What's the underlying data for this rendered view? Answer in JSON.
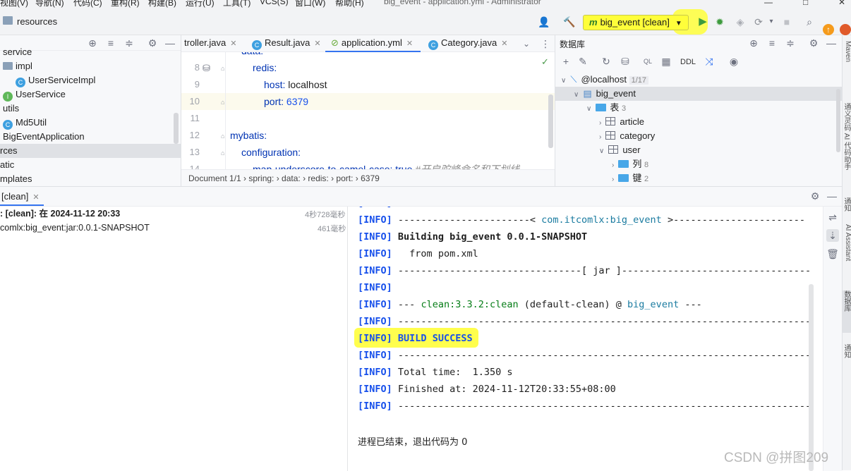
{
  "menubar": {
    "items": [
      "视图(V)",
      "导航(N)",
      "代码(C)",
      "重构(R)",
      "构建(B)",
      "运行(U)",
      "工具(T)",
      "VCS(S)",
      "窗口(W)",
      "帮助(H)"
    ],
    "title": "big_event - application.yml - Administrator"
  },
  "toolbar": {
    "project_label": "resources",
    "run_config": "big_event [clean]",
    "run_config_icon": "m"
  },
  "project_tree": {
    "rows": [
      {
        "label": "service",
        "icon": "none"
      },
      {
        "label": "impl",
        "icon": "folder"
      },
      {
        "label": "UserServiceImpl",
        "icon": "class"
      },
      {
        "label": "UserService",
        "icon": "interface"
      },
      {
        "label": "utils",
        "icon": "none"
      },
      {
        "label": "Md5Util",
        "icon": "class"
      },
      {
        "label": "BigEventApplication",
        "icon": "none"
      },
      {
        "label": "rces",
        "icon": "none"
      },
      {
        "label": "atic",
        "icon": "none"
      },
      {
        "label": "mplates",
        "icon": "none"
      }
    ]
  },
  "editor": {
    "tabs": [
      {
        "label": "troller.java",
        "icon": "none"
      },
      {
        "label": "Result.java",
        "icon": "class"
      },
      {
        "label": "application.yml",
        "icon": "yaml"
      },
      {
        "label": "Category.java",
        "icon": "class"
      }
    ],
    "lines": [
      {
        "num": "",
        "key": "data:",
        "value": "",
        "type": "k"
      },
      {
        "num": "8",
        "key": "redis:",
        "value": "",
        "type": "k"
      },
      {
        "num": "9",
        "key": "host:",
        "value": "localhost",
        "type": "kv"
      },
      {
        "num": "10",
        "key": "port:",
        "value": "6379",
        "type": "kn"
      },
      {
        "num": "11",
        "key": "",
        "value": "",
        "type": "k"
      },
      {
        "num": "12",
        "key": "mybatis:",
        "value": "",
        "type": "k"
      },
      {
        "num": "13",
        "key": "configuration:",
        "value": "",
        "type": "k"
      },
      {
        "num": "14",
        "key": "map-underscore-to-camel-case:",
        "value": "true",
        "type": "partial",
        "comment": "#开启驼峰命名和下划线"
      }
    ],
    "breadcrumb": "Document 1/1  ›  spring:  ›  data:  ›  redis:  ›  port:  ›  6379"
  },
  "database": {
    "title": "数据库",
    "ddl": "DDL",
    "datasource": "@localhost",
    "datasource_count": "1/17",
    "schema": "big_event",
    "tables_label": "表",
    "tables_count": "3",
    "tables": [
      "article",
      "category",
      "user"
    ],
    "columns_label": "列",
    "columns_count": "8",
    "keys_label": "键",
    "keys_count": "2"
  },
  "right_strip": {
    "labels": [
      "Maven",
      "通义灵码 AI 代码助手",
      "通知",
      "AI Assistant",
      "数据库",
      "通知"
    ]
  },
  "run": {
    "tab_label": "[clean]",
    "tree": [
      {
        "label": ": [clean]: 在 2024-11-12 20:33",
        "time": "4秒728毫秒"
      },
      {
        "label": "comlx:big_event:jar:0.0.1-SNAPSHOT",
        "time": "461毫秒"
      }
    ],
    "console": [
      {
        "tag": "[INFO]",
        "text": "-----------------------< ",
        "link": "com.itcomlx:big_event",
        "tail": " >-----------------------"
      },
      {
        "tag": "[INFO]",
        "text": "Building big_event 0.0.1-SNAPSHOT",
        "bold": true
      },
      {
        "tag": "[INFO]",
        "text": "  from pom.xml"
      },
      {
        "tag": "[INFO]",
        "text": "--------------------------------[ jar ]---------------------------------"
      },
      {
        "tag": "[INFO]",
        "text": ""
      },
      {
        "tag": "[INFO]",
        "text": "--- ",
        "green": "clean:3.3.2:clean",
        "mid": " (default-clean) @ ",
        "link2": "big_event",
        "tail": " ---"
      },
      {
        "tag": "[INFO]",
        "text": "------------------------------------------------------------------------"
      },
      {
        "tag": "[INFO]",
        "text": "BUILD SUCCESS",
        "bold": true
      },
      {
        "tag": "[INFO]",
        "text": "------------------------------------------------------------------------"
      },
      {
        "tag": "[INFO]",
        "text": "Total time:  1.350 s"
      },
      {
        "tag": "[INFO]",
        "text": "Finished at: 2024-11-12T20:33:55+08:00"
      },
      {
        "tag": "[INFO]",
        "text": "------------------------------------------------------------------------"
      }
    ],
    "exit_message": "进程已结束，退出代码为 0",
    "watermark": "CSDN @拼图209"
  },
  "colors": {
    "highlight": "#fffe3a",
    "accent": "#3574f0",
    "info": "#1750eb",
    "green": "#067d17"
  }
}
